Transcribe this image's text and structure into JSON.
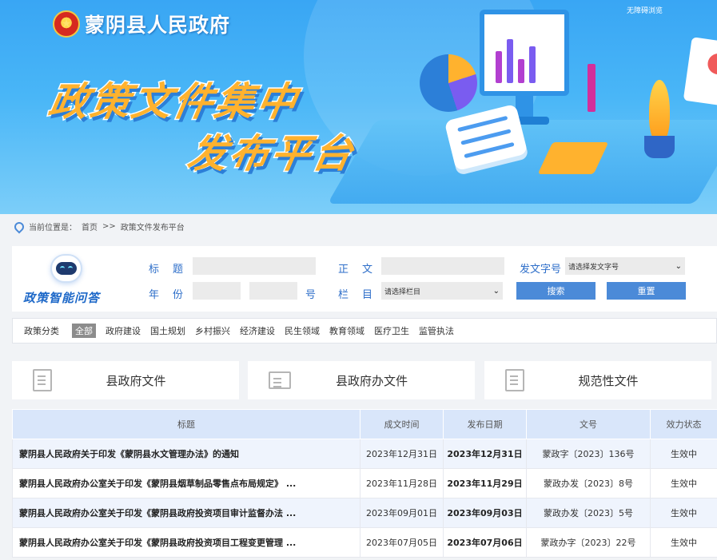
{
  "header": {
    "site_name": "蒙阴县人民政府",
    "accessible_link": "无障碍浏览",
    "banner_line1": "政策文件集中",
    "banner_line2": "发布平台"
  },
  "breadcrumb": {
    "prefix": "当前位置是：",
    "home": "首页",
    "separator": ">>",
    "current": "政策文件发布平台"
  },
  "search": {
    "robot_label": "政策智能问答",
    "title_label": "标　题",
    "body_label": "正　文",
    "docnum_label": "发文字号",
    "docnum_placeholder": "请选择发文字号",
    "year_label": "年　份",
    "number_label": "号",
    "column_label": "栏　目",
    "column_placeholder": "请选择栏目",
    "search_button": "搜索",
    "reset_button": "重置"
  },
  "categories": {
    "head": "政策分类",
    "items": [
      "全部",
      "政府建设",
      "国土规划",
      "乡村振兴",
      "经济建设",
      "民生领域",
      "教育领域",
      "医疗卫生",
      "监管执法"
    ]
  },
  "doc_types": [
    "县政府文件",
    "县政府办文件",
    "规范性文件"
  ],
  "table": {
    "columns": [
      "标题",
      "成文时间",
      "发布日期",
      "文号",
      "效力状态"
    ],
    "rows": [
      {
        "title": "蒙阴县人民政府关于印发《蒙阴县水文管理办法》的通知",
        "written": "2023年12月31日",
        "published": "2023年12月31日",
        "docnum": "蒙政字〔2023〕136号",
        "status": "生效中"
      },
      {
        "title": "蒙阴县人民政府办公室关于印发《蒙阴县烟草制品零售点布局规定》 ...",
        "written": "2023年11月28日",
        "published": "2023年11月29日",
        "docnum": "蒙政办发〔2023〕8号",
        "status": "生效中"
      },
      {
        "title": "蒙阴县人民政府办公室关于印发《蒙阴县政府投资项目审计监督办法 ...",
        "written": "2023年09月01日",
        "published": "2023年09月03日",
        "docnum": "蒙政办发〔2023〕5号",
        "status": "生效中"
      },
      {
        "title": "蒙阴县人民政府办公室关于印发《蒙阴县政府投资项目工程变更管理 ...",
        "written": "2023年07月05日",
        "published": "2023年07月06日",
        "docnum": "蒙政办字〔2023〕22号",
        "status": "生效中"
      }
    ]
  }
}
